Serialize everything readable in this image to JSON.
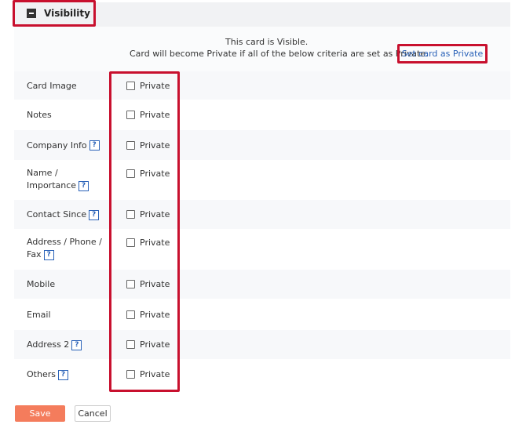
{
  "visibility": {
    "title": "Visibility",
    "status_line": "This card is Visible.",
    "criteria_line": "Card will become Private if all of the below criteria are set as Private.",
    "set_private_label": "Set card as Private"
  },
  "fields": [
    {
      "label": "Card Image",
      "help": false,
      "private_label": "Private",
      "checked": false
    },
    {
      "label": "Notes",
      "help": false,
      "private_label": "Private",
      "checked": false
    },
    {
      "label": "Company Info",
      "help": true,
      "private_label": "Private",
      "checked": false
    },
    {
      "label": "Name / Importance",
      "help": true,
      "private_label": "Private",
      "checked": false
    },
    {
      "label": "Contact Since",
      "help": true,
      "private_label": "Private",
      "checked": false
    },
    {
      "label": "Address / Phone / Fax",
      "help": true,
      "private_label": "Private",
      "checked": false
    },
    {
      "label": "Mobile",
      "help": false,
      "private_label": "Private",
      "checked": false
    },
    {
      "label": "Email",
      "help": false,
      "private_label": "Private",
      "checked": false
    },
    {
      "label": "Address 2",
      "help": true,
      "private_label": "Private",
      "checked": false
    },
    {
      "label": "Others",
      "help": true,
      "private_label": "Private",
      "checked": false
    }
  ],
  "help_glyph": "?",
  "actions": {
    "save_label": "Save",
    "cancel_label": "Cancel"
  },
  "colors": {
    "highlight": "#c8102e",
    "link": "#2a62b8",
    "save": "#f47c5c"
  }
}
